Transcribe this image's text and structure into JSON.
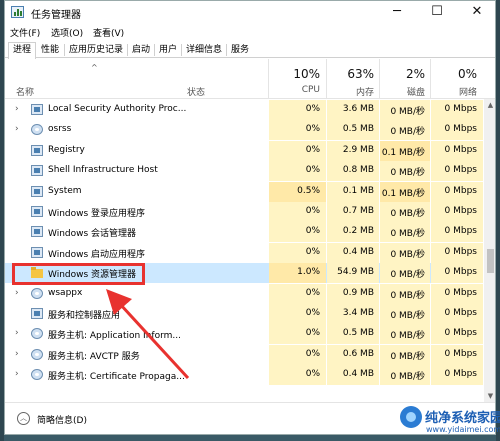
{
  "window": {
    "title": "任务管理器",
    "controls": {
      "minimize": "─",
      "maximize": "☐",
      "close": "✕"
    }
  },
  "menu": [
    "文件(F)",
    "选项(O)",
    "查看(V)"
  ],
  "tabs": [
    "进程",
    "性能",
    "应用历史记录",
    "启动",
    "用户",
    "详细信息",
    "服务"
  ],
  "active_tab": "进程",
  "columns": {
    "sort_indicator": "^",
    "name": "名称",
    "status": "状态",
    "cpu": {
      "pct": "10%",
      "label": "CPU"
    },
    "memory": {
      "pct": "63%",
      "label": "内存"
    },
    "disk": {
      "pct": "2%",
      "label": "磁盘"
    },
    "network": {
      "pct": "0%",
      "label": "网络"
    }
  },
  "processes": [
    {
      "name": "Local Security Authority Proc...",
      "cpu": "0%",
      "memory": "3.6 MB",
      "disk": "0 MB/秒",
      "network": "0 Mbps",
      "expand": "›",
      "icon": "app-icon"
    },
    {
      "name": "osrss",
      "cpu": "0%",
      "memory": "0.5 MB",
      "disk": "0 MB/秒",
      "network": "0 Mbps",
      "expand": "›",
      "icon": "gear-icon"
    },
    {
      "name": "Registry",
      "cpu": "0%",
      "memory": "2.9 MB",
      "disk": "0.1 MB/秒",
      "network": "0 Mbps",
      "expand": "",
      "icon": "app-icon"
    },
    {
      "name": "Shell Infrastructure Host",
      "cpu": "0%",
      "memory": "0.8 MB",
      "disk": "0 MB/秒",
      "network": "0 Mbps",
      "expand": "",
      "icon": "app-icon"
    },
    {
      "name": "System",
      "cpu": "0.5%",
      "memory": "0.1 MB",
      "disk": "0.1 MB/秒",
      "network": "0 Mbps",
      "expand": "",
      "icon": "app-icon"
    },
    {
      "name": "Windows 登录应用程序",
      "cpu": "0%",
      "memory": "0.7 MB",
      "disk": "0 MB/秒",
      "network": "0 Mbps",
      "expand": "",
      "icon": "app-icon"
    },
    {
      "name": "Windows 会话管理器",
      "cpu": "0%",
      "memory": "0.2 MB",
      "disk": "0 MB/秒",
      "network": "0 Mbps",
      "expand": "",
      "icon": "app-icon"
    },
    {
      "name": "Windows 启动应用程序",
      "cpu": "0%",
      "memory": "0.4 MB",
      "disk": "0 MB/秒",
      "network": "0 Mbps",
      "expand": "",
      "icon": "app-icon"
    },
    {
      "name": "Windows 资源管理器",
      "cpu": "1.0%",
      "memory": "54.9 MB",
      "disk": "0 MB/秒",
      "network": "0 Mbps",
      "expand": "",
      "icon": "folder-icon",
      "selected": true
    },
    {
      "name": "wsappx",
      "cpu": "0%",
      "memory": "0.9 MB",
      "disk": "0 MB/秒",
      "network": "0 Mbps",
      "expand": "›",
      "icon": "gear-icon"
    },
    {
      "name": "服务和控制器应用",
      "cpu": "0%",
      "memory": "3.4 MB",
      "disk": "0 MB/秒",
      "network": "0 Mbps",
      "expand": "",
      "icon": "app-icon"
    },
    {
      "name": "服务主机: Application Inform...",
      "cpu": "0%",
      "memory": "0.5 MB",
      "disk": "0 MB/秒",
      "network": "0 Mbps",
      "expand": "›",
      "icon": "gear-icon"
    },
    {
      "name": "服务主机: AVCTP 服务",
      "cpu": "0%",
      "memory": "0.6 MB",
      "disk": "0 MB/秒",
      "network": "0 Mbps",
      "expand": "›",
      "icon": "gear-icon"
    },
    {
      "name": "服务主机: Certificate Propaga...",
      "cpu": "0%",
      "memory": "0.4 MB",
      "disk": "0 MB/秒",
      "network": "0 Mbps",
      "expand": "›",
      "icon": "gear-icon"
    }
  ],
  "scrollbar": {
    "up": "▲",
    "down": "▼"
  },
  "footer": {
    "icon": "︿",
    "label": "简略信息(D)"
  },
  "watermark": {
    "title": "纯净系统家园",
    "url": "www.yidaimei.com"
  },
  "colors": {
    "selection": "#cce8ff",
    "heat_light": "#fff4c4",
    "heat_medium": "#ffe9a8",
    "annotation": "#e8322f"
  }
}
